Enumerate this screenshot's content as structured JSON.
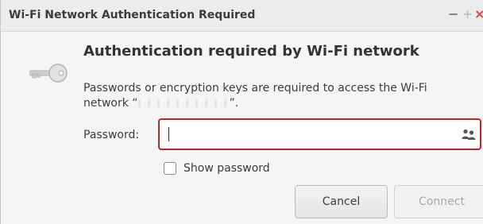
{
  "window": {
    "title": "Wi-Fi Network Authentication Required",
    "minimize_glyph": "−",
    "maximize_glyph": "+",
    "close_glyph": "×"
  },
  "dialog": {
    "icon": "key-icon",
    "heading": "Authentication required by Wi-Fi network",
    "message_before": "Passwords or encryption keys are required to access the Wi-Fi network “",
    "message_after": "”."
  },
  "password": {
    "label": "Password:",
    "value": "",
    "placeholder": "",
    "trailing_icon": "users-icon",
    "focus_color": "#c4232a"
  },
  "show_password": {
    "label": "Show password",
    "checked": false
  },
  "buttons": {
    "cancel": "Cancel",
    "connect": "Connect"
  }
}
